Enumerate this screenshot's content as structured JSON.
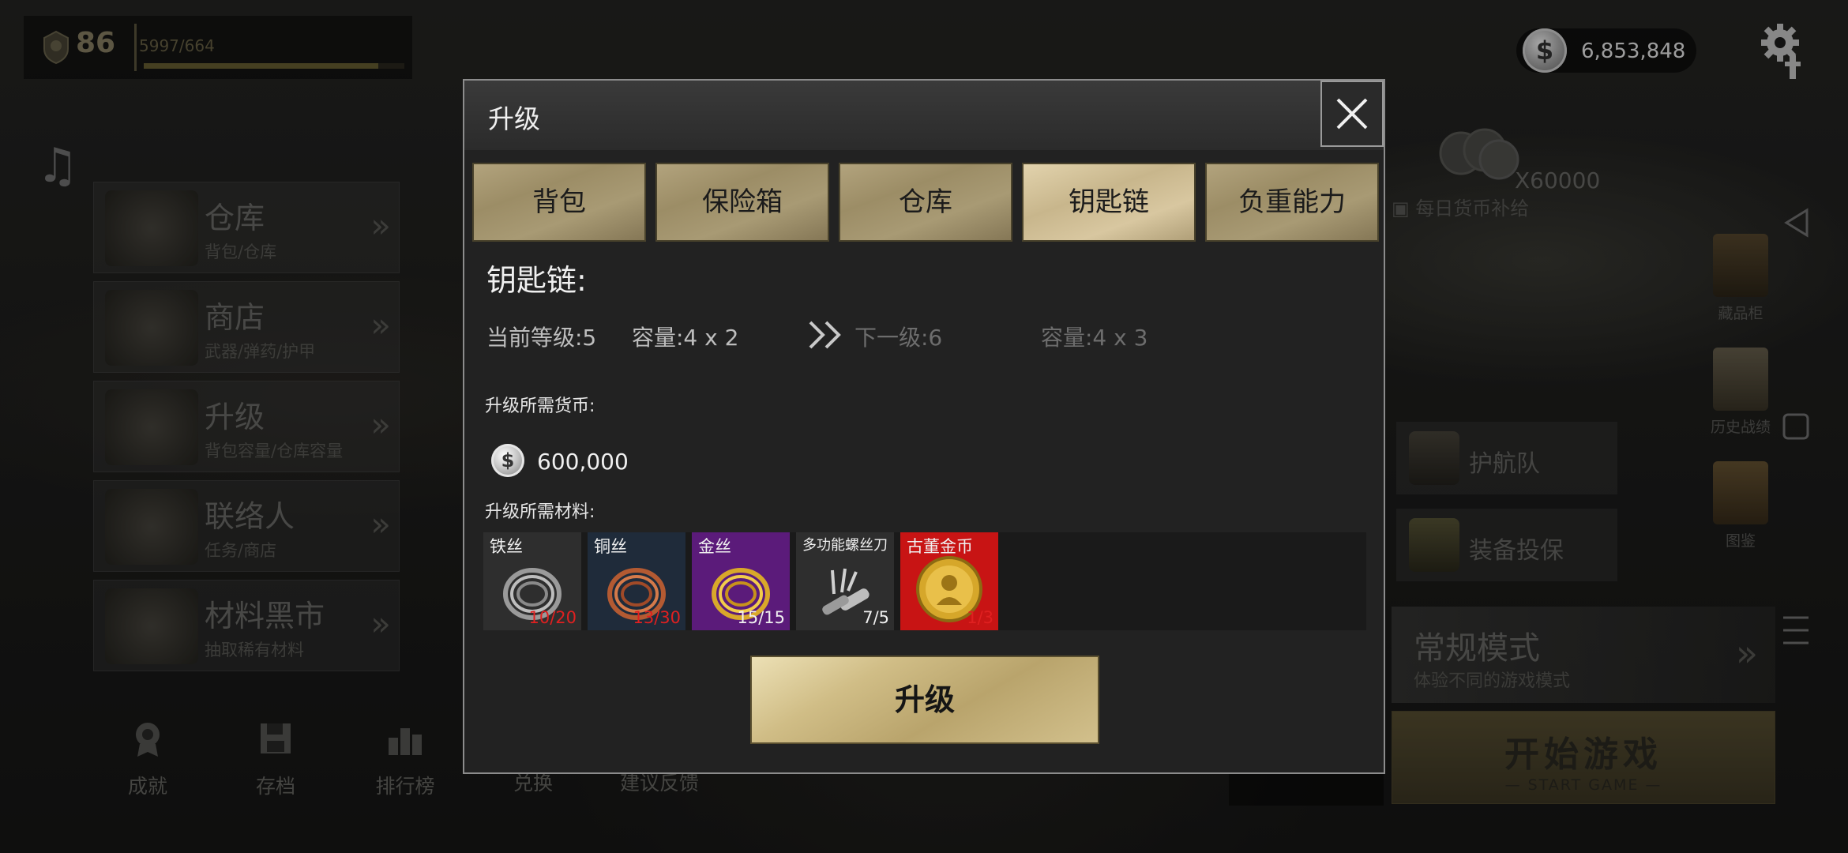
{
  "player": {
    "level": "86",
    "xp": "5997/664",
    "xp_progress": 0.9
  },
  "currency": {
    "value": "6,853,848",
    "icon": "silver-coin-icon"
  },
  "daily": {
    "amount": "X60000",
    "label": "每日货币补给"
  },
  "left_menu": [
    {
      "title": "仓库",
      "subtitle": "背包/仓库"
    },
    {
      "title": "商店",
      "subtitle": "武器/弹药/护甲"
    },
    {
      "title": "升级",
      "subtitle": "背包容量/仓库容量"
    },
    {
      "title": "联络人",
      "subtitle": "任务/商店"
    },
    {
      "title": "材料黑市",
      "subtitle": "抽取稀有材料"
    }
  ],
  "bottom_nav": [
    "成就",
    "存档",
    "排行榜",
    "兑换",
    "建议反馈"
  ],
  "right_side": {
    "cabinet": "藏品柜",
    "history": "历史战绩",
    "atlas": "图鉴"
  },
  "right_panels": {
    "escort": "护航队",
    "insure": "装备投保"
  },
  "mode": {
    "title": "常规模式",
    "subtitle": "体验不同的游戏模式"
  },
  "start": {
    "main": "开始游戏",
    "sub": "— START GAME —"
  },
  "dialog": {
    "title": "升级",
    "tabs": [
      "背包",
      "保险箱",
      "仓库",
      "钥匙链",
      "负重能力"
    ],
    "active_tab": 3,
    "section_title": "钥匙链:",
    "current_level": "当前等级:5",
    "current_capacity": "容量:4 x 2",
    "next_level": "下一级:6",
    "next_capacity": "容量:4 x 3",
    "currency_label": "升级所需货币:",
    "currency_cost": "600,000",
    "materials_label": "升级所需材料:",
    "materials": [
      {
        "name": "铁丝",
        "count": "10/20",
        "enough": false,
        "bg": "#2e2e2e",
        "art": "wire-coil-gray"
      },
      {
        "name": "铜丝",
        "count": "13/30",
        "enough": false,
        "bg": "#1f2b3a",
        "art": "wire-coil-copper"
      },
      {
        "name": "金丝",
        "count": "15/15",
        "enough": true,
        "bg": "#5b1b7a",
        "art": "wire-coil-gold"
      },
      {
        "name": "多功能螺丝刀",
        "count": "7/5",
        "enough": true,
        "bg": "#2e2e2e",
        "art": "multi-screwdriver"
      },
      {
        "name": "古董金币",
        "count": "1/3",
        "enough": false,
        "bg": "#c81414",
        "art": "antique-gold-coin"
      }
    ],
    "upgrade_button": "升级"
  }
}
